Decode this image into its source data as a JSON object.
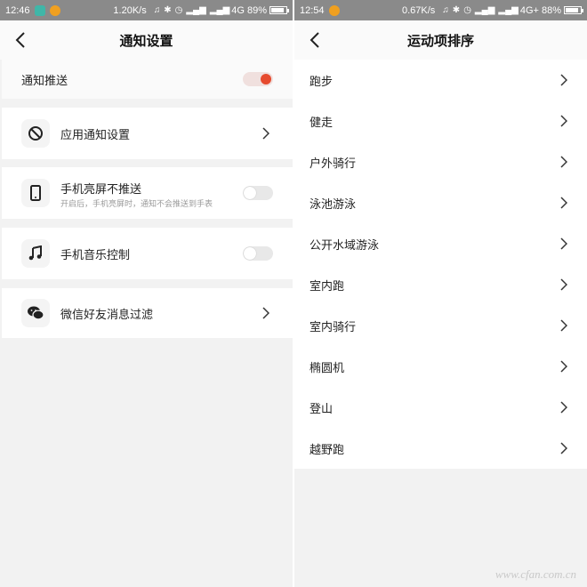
{
  "left_screen": {
    "statusbar": {
      "time": "12:46",
      "speed": "1.20K/s",
      "network": "4G",
      "battery": "89%",
      "battery_level": 0.89
    },
    "title": "通知设置",
    "notify_push": {
      "label": "通知推送",
      "enabled": true
    },
    "app_notify": {
      "label": "应用通知设置"
    },
    "screen_on": {
      "label": "手机亮屏不推送",
      "sub": "开启后，手机亮屏时，通知不会推送到手表",
      "enabled": false
    },
    "music": {
      "label": "手机音乐控制",
      "enabled": false
    },
    "wechat": {
      "label": "微信好友消息过滤"
    }
  },
  "right_screen": {
    "statusbar": {
      "time": "12:54",
      "speed": "0.67K/s",
      "network": "4G+",
      "battery": "88%",
      "battery_level": 0.88
    },
    "title": "运动项排序",
    "sports": [
      "跑步",
      "健走",
      "户外骑行",
      "泳池游泳",
      "公开水域游泳",
      "室内跑",
      "室内骑行",
      "椭圆机",
      "登山",
      "越野跑"
    ]
  },
  "watermark": "www.cfan.com.cn",
  "colors": {
    "accent": "#e64a2e",
    "statusbar": "#8a8a8a",
    "background": "#f2f2f2"
  }
}
